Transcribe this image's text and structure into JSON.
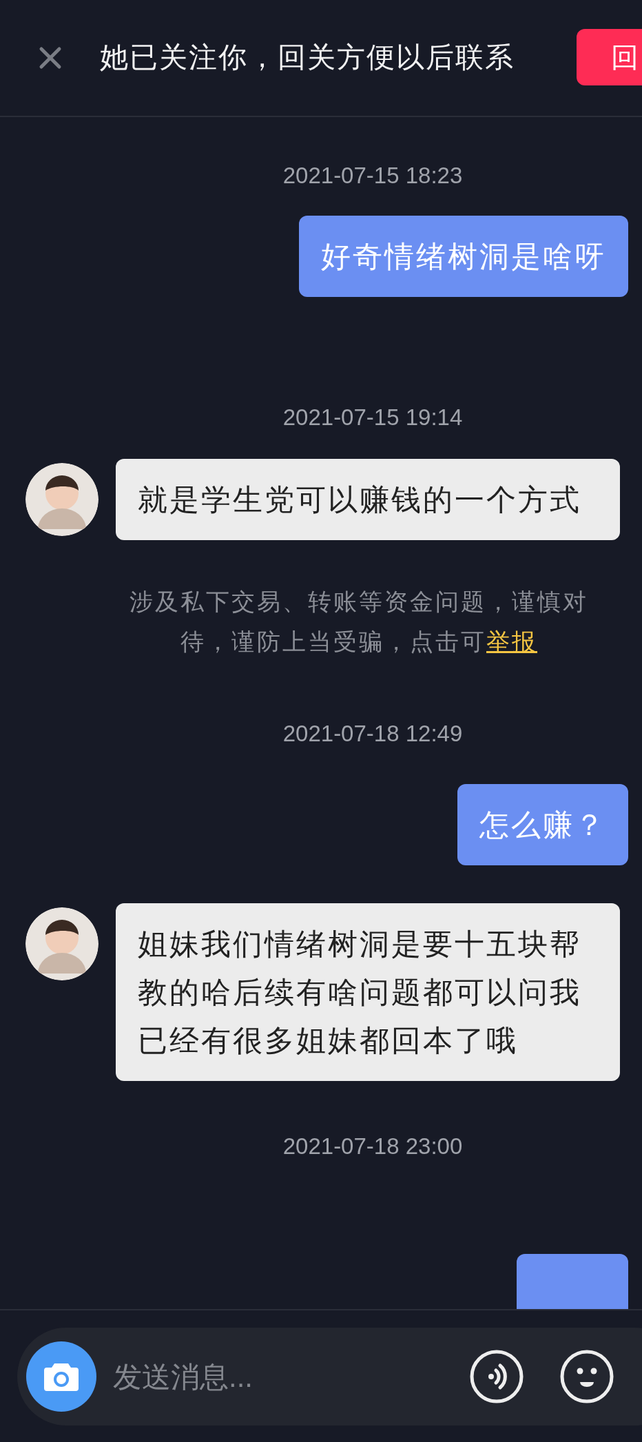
{
  "header": {
    "title": "她已关注你，回关方便以后联系",
    "follow_button": "回"
  },
  "messages": [
    {
      "kind": "timestamp",
      "text": "2021-07-15 18:23"
    },
    {
      "kind": "sent",
      "text": "好奇情绪树洞是啥呀"
    },
    {
      "kind": "timestamp",
      "text": "2021-07-15 19:14"
    },
    {
      "kind": "received",
      "text": "就是学生党可以赚钱的一个方式"
    },
    {
      "kind": "notice",
      "text": "涉及私下交易、转账等资金问题，谨慎对待，谨防上当受骗，点击可",
      "link": "举报"
    },
    {
      "kind": "timestamp",
      "text": "2021-07-18 12:49"
    },
    {
      "kind": "sent",
      "text": "怎么赚？"
    },
    {
      "kind": "received",
      "text": "姐妹我们情绪树洞是要十五块帮教的哈后续有啥问题都可以问我已经有很多姐妹都回本了哦"
    },
    {
      "kind": "timestamp",
      "text": "2021-07-18 23:00"
    },
    {
      "kind": "partial"
    }
  ],
  "composer": {
    "placeholder": "发送消息..."
  }
}
